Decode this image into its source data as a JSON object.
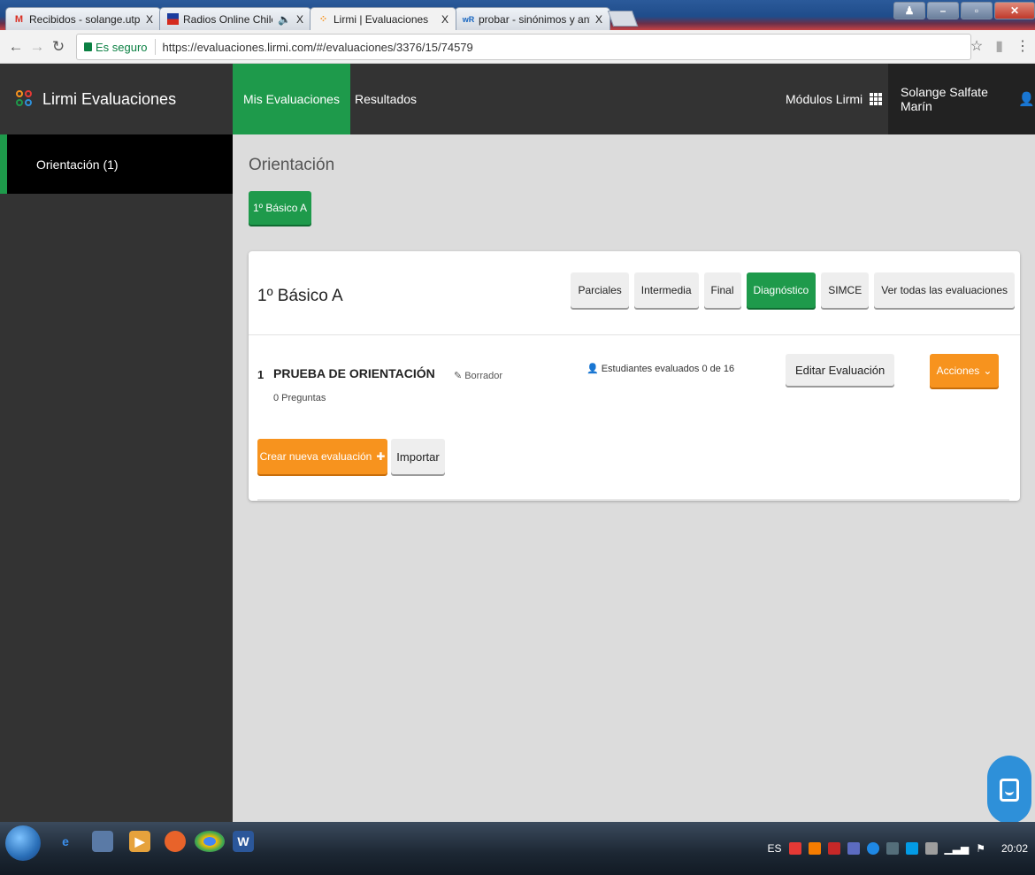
{
  "browser": {
    "tabs": [
      {
        "title": "Recibidos - solange.utp@",
        "favicon": "M",
        "close": "X"
      },
      {
        "title": "Radios Online Chile, e",
        "favicon": "chile-flag-icon",
        "close": "X"
      },
      {
        "title": "Lirmi | Evaluaciones",
        "favicon": "lirmi-logo-icon",
        "close": "X"
      },
      {
        "title": "probar - sinónimos y ant",
        "favicon": "wR",
        "close": "X"
      }
    ],
    "secure_label": "Es seguro",
    "url": "https://evaluaciones.lirmi.com/#/evaluaciones/3376/15/74579"
  },
  "app": {
    "brand": "Lirmi Evaluaciones",
    "nav": {
      "mis_evaluaciones": "Mis Evaluaciones",
      "resultados": "Resultados"
    },
    "modules_label": "Módulos Lirmi",
    "user_name": "Solange Salfate Marín"
  },
  "sidebar": {
    "items": [
      {
        "label": "Orientación (1)"
      }
    ]
  },
  "main": {
    "title": "Orientación",
    "course_chip": "1º Básico A",
    "card": {
      "title": "1º Básico A",
      "filters": [
        "Parciales",
        "Intermedia",
        "Final",
        "Diagnóstico",
        "SIMCE",
        "Ver todas las evaluaciones"
      ],
      "selected_filter": "Diagnóstico",
      "evaluations": [
        {
          "number": "1",
          "name": "PRUEBA DE ORIENTACIÓN",
          "questions": "0 Preguntas",
          "status": "Borrador",
          "students": "Estudiantes evaluados 0 de 16",
          "edit_label": "Editar Evaluación",
          "actions_label": "Acciones"
        }
      ],
      "create_label": "Crear nueva evaluación",
      "import_label": "Importar"
    }
  },
  "taskbar": {
    "lang": "ES",
    "time": "20:02"
  },
  "colors": {
    "green": "#1e9a4b",
    "orange": "#f7931e",
    "dark": "#333333",
    "chat_blue": "#2e90d9"
  }
}
